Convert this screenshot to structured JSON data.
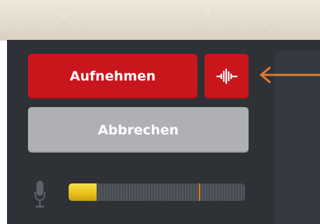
{
  "recorder": {
    "record_label": "Aufnehmen",
    "cancel_label": "Abbrechen",
    "waveform_button_icon": "audio-waveform-icon",
    "microphone_icon": "microphone-icon",
    "level_meter": {
      "level": 0.16,
      "peak": 0.74
    }
  },
  "annotation": {
    "arrow_icon": "arrow-left-icon",
    "arrow_color": "#e07a2c"
  },
  "colors": {
    "record_red": "#c8161c",
    "cancel_gray": "#aeb0b4",
    "panel_dark": "#2e3136",
    "meter_yellow": "#e8c21a",
    "meter_peak": "#e8781a"
  }
}
